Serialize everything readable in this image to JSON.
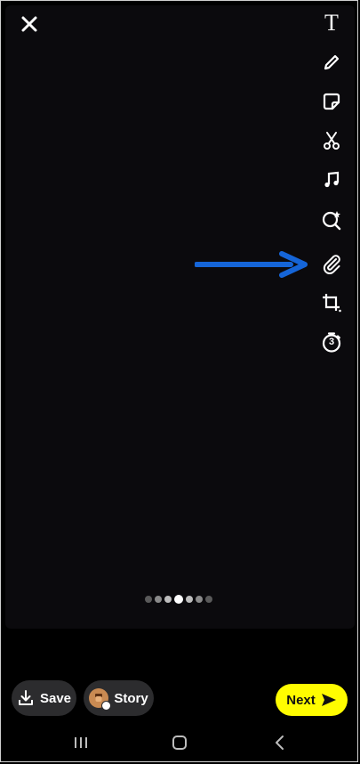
{
  "toolbar": {
    "text_tool_label": "T",
    "icons": [
      "text-icon",
      "pencil-icon",
      "sticker-icon",
      "scissors-icon",
      "music-icon",
      "lens-search-icon",
      "paperclip-icon",
      "crop-icon",
      "timer-icon"
    ],
    "timer_value": "3"
  },
  "page_indicator": {
    "total": 7,
    "active_index": 3
  },
  "actions": {
    "save_label": "Save",
    "story_label": "Story",
    "next_label": "Next"
  },
  "colors": {
    "accent": "#fffc00",
    "annotation_arrow": "#1565d8",
    "canvas": "#0b0a0d"
  }
}
